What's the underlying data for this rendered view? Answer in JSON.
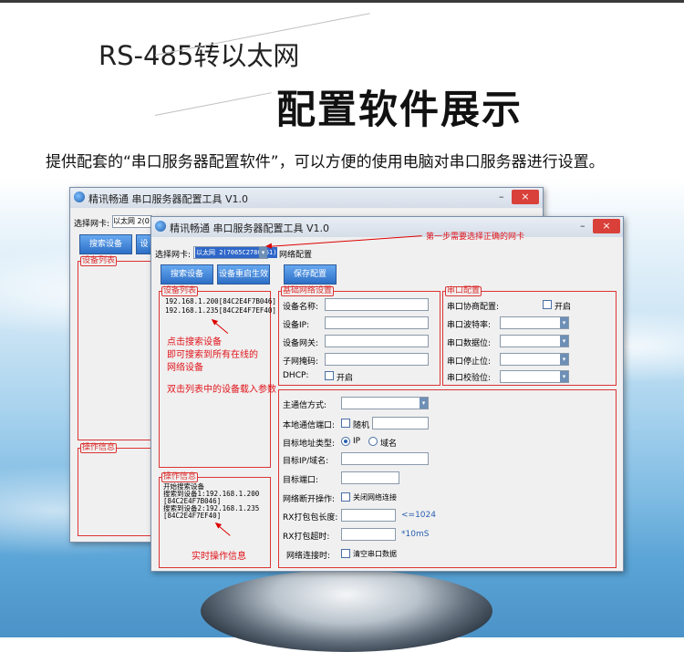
{
  "header": {
    "line1": "RS-485转以太网",
    "line2": "配置软件展示",
    "subtitle": "提供配套的“串口服务器配置软件”，可以方便的使用电脑对串口服务器进行设置。"
  },
  "back_window": {
    "title": "精讯畅通 串口服务器配置工具 V1.0",
    "min": "–",
    "close": "×",
    "nic_label": "选择网卡:",
    "nic_value": "以太网 2(0",
    "search_btn": "搜索设备",
    "set_btn": "设",
    "device_list_title": "设备列表",
    "log_title": "操作信息"
  },
  "front_window": {
    "title": "精讯畅通 串口服务器配置工具 V1.0",
    "min": "–",
    "close": "×",
    "nic_label": "选择网卡:",
    "nic_value": "以太网 2(7065C278CD61)",
    "net_config": "网络配置",
    "search_btn": "搜索设备",
    "reset_btn": "设备重启生效",
    "save_btn": "保存配置",
    "device_list_title": "设备列表",
    "devices": [
      "192.168.1.200[84C2E4F7B046]",
      "192.168.1.235[84C2E4F7EF40]"
    ],
    "basic": {
      "title": "基础网络设置",
      "name": "设备名称:",
      "ip": "设备IP:",
      "gateway": "设备网关:",
      "mask": "子网掩码:",
      "dhcp": "DHCP:",
      "dhcp_open": "开启"
    },
    "serial": {
      "title": "串口配置",
      "protocol": "串口协商配置:",
      "protocol_open": "开启",
      "baud": "串口波特率:",
      "databits": "串口数据位:",
      "stopbits": "串口停止位:",
      "parity": "串口校验位:"
    },
    "comm": {
      "mode": "主通信方式:",
      "local_port": "本地通信端口:",
      "random": "随机",
      "target_type": "目标地址类型:",
      "ip_opt": "IP",
      "domain_opt": "域名",
      "target_ip": "目标IP/域名:",
      "target_port": "目标端口:",
      "disconnect": "网络断开操作:",
      "close_conn": "关闭网络连接",
      "rx_len": "RX打包包长度:",
      "rx_len_unit": "<=1024",
      "rx_timeout": "RX打包超时:",
      "rx_timeout_unit": "*10mS",
      "conn_time": "网络连接时:",
      "clear_data": "清空串口数据"
    },
    "log_title": "操作信息",
    "log_lines": [
      "开始搜索设备",
      "搜索到设备1:192.168.1.200",
      "[84C2E4F7B046]",
      "搜索到设备2:192.168.1.235",
      "[84C2E4F7EF40]"
    ]
  },
  "annotations": {
    "step1": "第一步需要选择正确的网卡",
    "search1": "点击搜索设备",
    "search2": "即可搜索到所有在线的",
    "search3": "网络设备",
    "dblclick": "双击列表中的设备载入参数",
    "realtime": "实时操作信息"
  }
}
